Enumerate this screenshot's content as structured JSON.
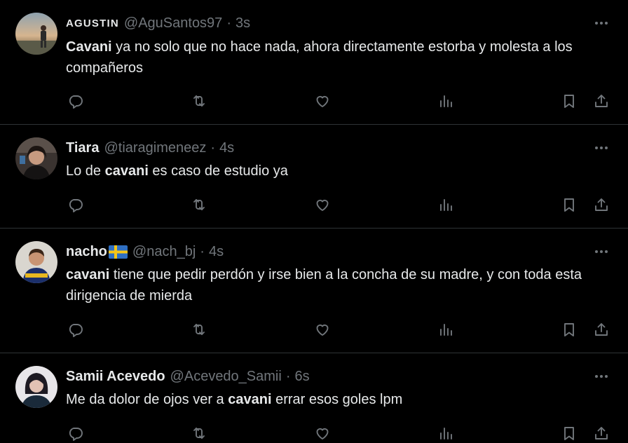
{
  "colors": {
    "background": "#000000",
    "text_primary": "#e7e9ea",
    "text_secondary": "#71767b",
    "divider": "#2f3336"
  },
  "tweets": [
    {
      "display_name": "AGUSTIN",
      "handle": "@AguSantos97",
      "separator": "·",
      "time": "3s",
      "text_bold": "Cavani",
      "text_rest": " ya no solo que no hace nada, ahora directamente estorba y molesta a los compañeros",
      "icons": [
        "more-icon",
        "reply-icon",
        "retweet-icon",
        "like-icon",
        "views-icon",
        "bookmark-icon",
        "share-icon"
      ]
    },
    {
      "display_name": "Tiara",
      "handle": "@tiaragimeneez",
      "separator": "·",
      "time": "4s",
      "text_before": "Lo de ",
      "text_bold": "cavani",
      "text_after": " es caso de estudio ya",
      "icons": [
        "more-icon",
        "reply-icon",
        "retweet-icon",
        "like-icon",
        "views-icon",
        "bookmark-icon",
        "share-icon"
      ]
    },
    {
      "display_name": "nacho",
      "name_emoji": "sweden-flag-icon",
      "handle": "@nach_bj",
      "separator": "·",
      "time": "4s",
      "text_bold": "cavani",
      "text_rest": " tiene que pedir perdón y irse bien a la concha de su madre, y con toda esta dirigencia de mierda",
      "icons": [
        "more-icon",
        "reply-icon",
        "retweet-icon",
        "like-icon",
        "views-icon",
        "bookmark-icon",
        "share-icon"
      ]
    },
    {
      "display_name": "Samii Acevedo",
      "handle": "@Acevedo_Samii",
      "separator": "·",
      "time": "6s",
      "text_before": "Me da dolor de ojos ver a ",
      "text_bold": "cavani",
      "text_after": " errar esos goles lpm",
      "icons": [
        "more-icon",
        "reply-icon",
        "retweet-icon",
        "like-icon",
        "views-icon",
        "bookmark-icon",
        "share-icon"
      ]
    }
  ]
}
